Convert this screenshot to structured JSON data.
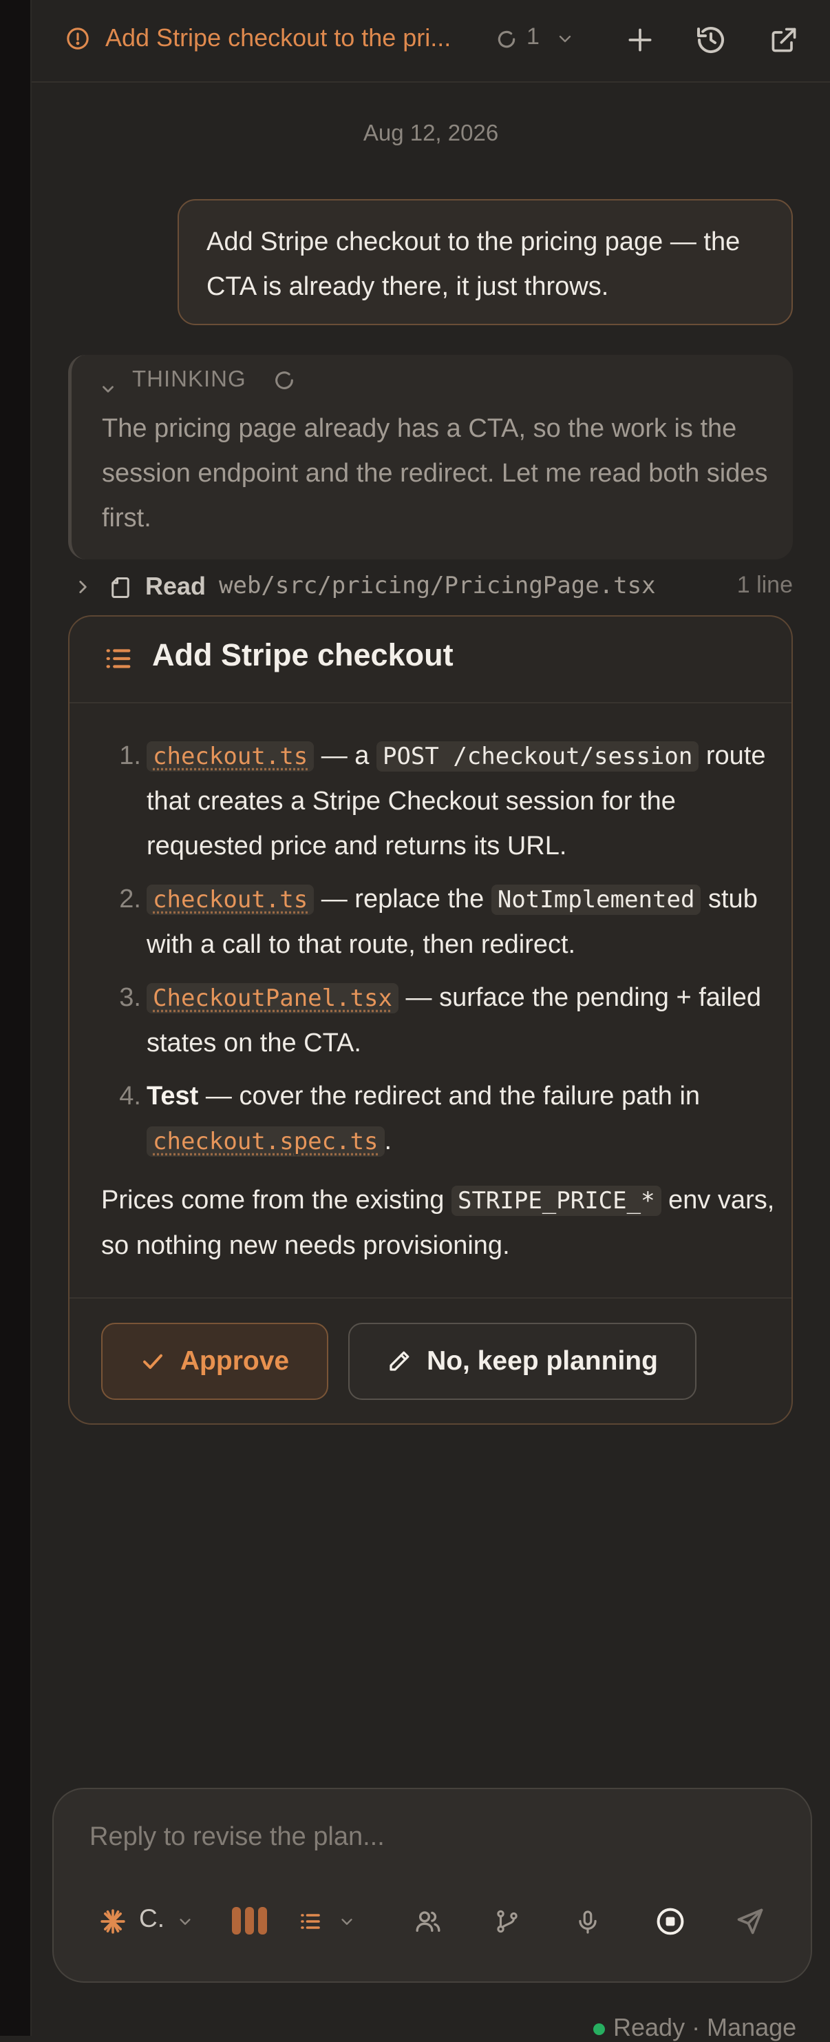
{
  "topbar": {
    "task_title": "Add Stripe checkout to the pri...",
    "pending_count": "1"
  },
  "conversation": {
    "date": "Aug 12, 2026",
    "user_message": "Add Stripe checkout to the pricing page — the CTA is already there, it just throws.",
    "thinking": {
      "label": "THINKING",
      "text": "The pricing page already has a CTA, so the work is the session endpoint and the redirect. Let me read both sides first."
    },
    "tool_call": {
      "verb": "Read",
      "path": "web/src/pricing/PricingPage.tsx",
      "meta": "1 line"
    }
  },
  "plan": {
    "title": "Add Stripe checkout",
    "steps": [
      {
        "num": "1.",
        "file": "checkout.ts",
        "t1": " — a ",
        "code": "POST /checkout/session",
        "t2": " route that creates a Stripe Checkout session for the requested price and returns its URL."
      },
      {
        "num": "2.",
        "file": "checkout.ts",
        "t1": " — replace the ",
        "code": "NotImplemented",
        "t2": " stub with a call to that route, then redirect."
      },
      {
        "num": "3.",
        "file": "CheckoutPanel.tsx",
        "t1": " — surface the pending + failed states on the CTA."
      },
      {
        "num": "4.",
        "bold": "Test",
        "t1": " — cover the redirect and the failure path in ",
        "file": "checkout.spec.ts",
        "t2": "."
      }
    ],
    "note": {
      "t1": "Prices come from the existing ",
      "code": "STRIPE_PRICE_*",
      "t2": " env vars, so nothing new needs provisioning."
    },
    "approve_label": "Approve",
    "keep_planning_label": "No, keep planning"
  },
  "composer": {
    "placeholder": "Reply to revise the plan...",
    "model_label": "C."
  },
  "status": {
    "text": "Ready · Manage",
    "dot_color": "#27ae60"
  },
  "colors": {
    "accent": "#e08a4e",
    "background": "#252321"
  }
}
